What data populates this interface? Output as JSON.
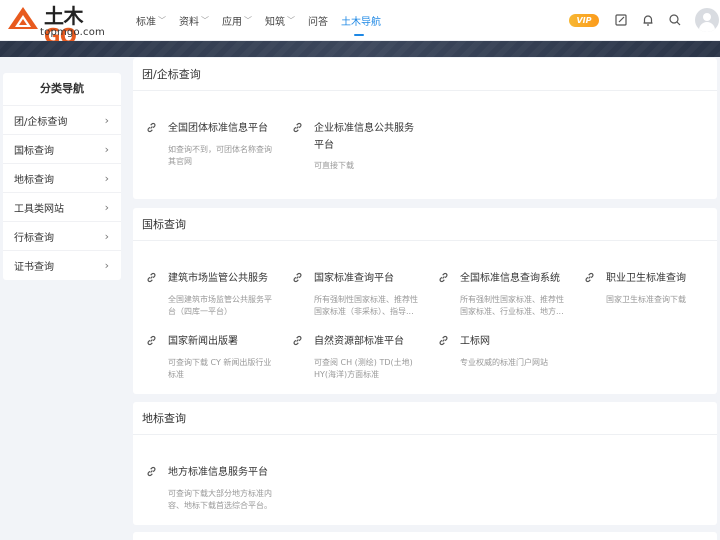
{
  "header": {
    "logo_text_main": "土木",
    "logo_text_go": "GO",
    "logo_url": "topmgo.com",
    "nav": [
      {
        "label": "标准",
        "has_dropdown": true
      },
      {
        "label": "资料",
        "has_dropdown": true
      },
      {
        "label": "应用",
        "has_dropdown": true
      },
      {
        "label": "知筑",
        "has_dropdown": true
      },
      {
        "label": "问答",
        "has_dropdown": false
      },
      {
        "label": "土木导航",
        "has_dropdown": false,
        "active": true
      }
    ],
    "chevron": "﹀",
    "vip_label": "VIP"
  },
  "sidebar": {
    "title": "分类导航",
    "items": [
      {
        "label": "团/企标查询"
      },
      {
        "label": "国标查询"
      },
      {
        "label": "地标查询"
      },
      {
        "label": "工具类网站"
      },
      {
        "label": "行标查询"
      },
      {
        "label": "证书查询"
      }
    ],
    "arrow": "›"
  },
  "sections": [
    {
      "title": "团/企标查询",
      "cards": [
        {
          "name": "全国团体标准信息平台",
          "desc": "如查询不到，可团体名称查询其官网"
        },
        {
          "name": "企业标准信息公共服务平台",
          "desc": "可直接下载"
        }
      ]
    },
    {
      "title": "国标查询",
      "cards": [
        {
          "name": "建筑市场监管公共服务",
          "desc": "全国建筑市场监管公共服务平台（四库一平台）"
        },
        {
          "name": "国家标准查询平台",
          "desc": "所有强制性国家标准、推荐性国家标准（非采标）、指导..."
        },
        {
          "name": "全国标准信息查询系统",
          "desc": "所有强制性国家标准、推荐性国家标准、行业标准、地方..."
        },
        {
          "name": "职业卫生标准查询",
          "desc": "国家卫生标准查询下载"
        },
        {
          "name": "国家新闻出版署",
          "desc": "可查询下载 CY 新闻出版行业标准"
        },
        {
          "name": "自然资源部标准平台",
          "desc": "可查阅 CH (测绘) TD(土地) HY(海洋)方面标准"
        },
        {
          "name": "工标网",
          "desc": "专业权威的标准门户网站"
        }
      ]
    },
    {
      "title": "地标查询",
      "cards": [
        {
          "name": "地方标准信息服务平台",
          "desc": "可查询下载大部分地方标准内容、地标下载首选综合平台。"
        }
      ]
    }
  ],
  "colors": {
    "accent": "#1e88e5",
    "brand": "#e85a1e",
    "vip": "#f7b733",
    "banner": "#2b3548"
  }
}
